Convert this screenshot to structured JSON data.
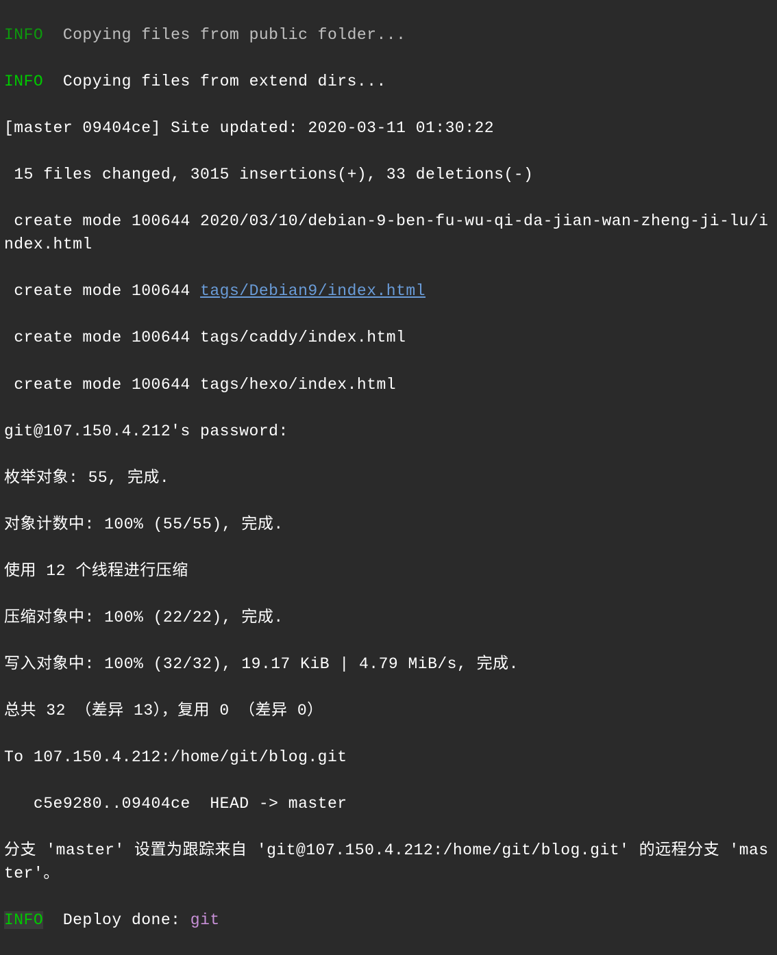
{
  "lines": {
    "l1_info": "INFO",
    "l1_text": "  Copying files from public folder...",
    "l2_info": "INFO",
    "l2_text": "  Copying files from extend dirs...",
    "l3": "[master 09404ce] Site updated: 2020-03-11 01:30:22",
    "l4": " 15 files changed, 3015 insertions(+), 33 deletions(-)",
    "l5": " create mode 100644 2020/03/10/debian-9-ben-fu-wu-qi-da-jian-wan-zheng-ji-lu/index.html",
    "l6a": " create mode 100644 ",
    "l6_link": "tags/Debian9/index.html",
    "l7": " create mode 100644 tags/caddy/index.html",
    "l8": " create mode 100644 tags/hexo/index.html",
    "l9": "git@107.150.4.212's password:",
    "l10": "枚举对象: 55, 完成.",
    "l11": "对象计数中: 100% (55/55), 完成.",
    "l12": "使用 12 个线程进行压缩",
    "l13": "压缩对象中: 100% (22/22), 完成.",
    "l14": "写入对象中: 100% (32/32), 19.17 KiB | 4.79 MiB/s, 完成.",
    "l15": "总共 32 （差异 13），复用 0 （差异 0）",
    "l16": "To 107.150.4.212:/home/git/blog.git",
    "l17": "   c5e9280..09404ce  HEAD -> master",
    "l18": "分支 'master' 设置为跟踪来自 'git@107.150.4.212:/home/git/blog.git' 的远程分支 'master'。",
    "l19_info": "INFO",
    "l19_text": "  Deploy done: ",
    "l19_git": "git"
  }
}
